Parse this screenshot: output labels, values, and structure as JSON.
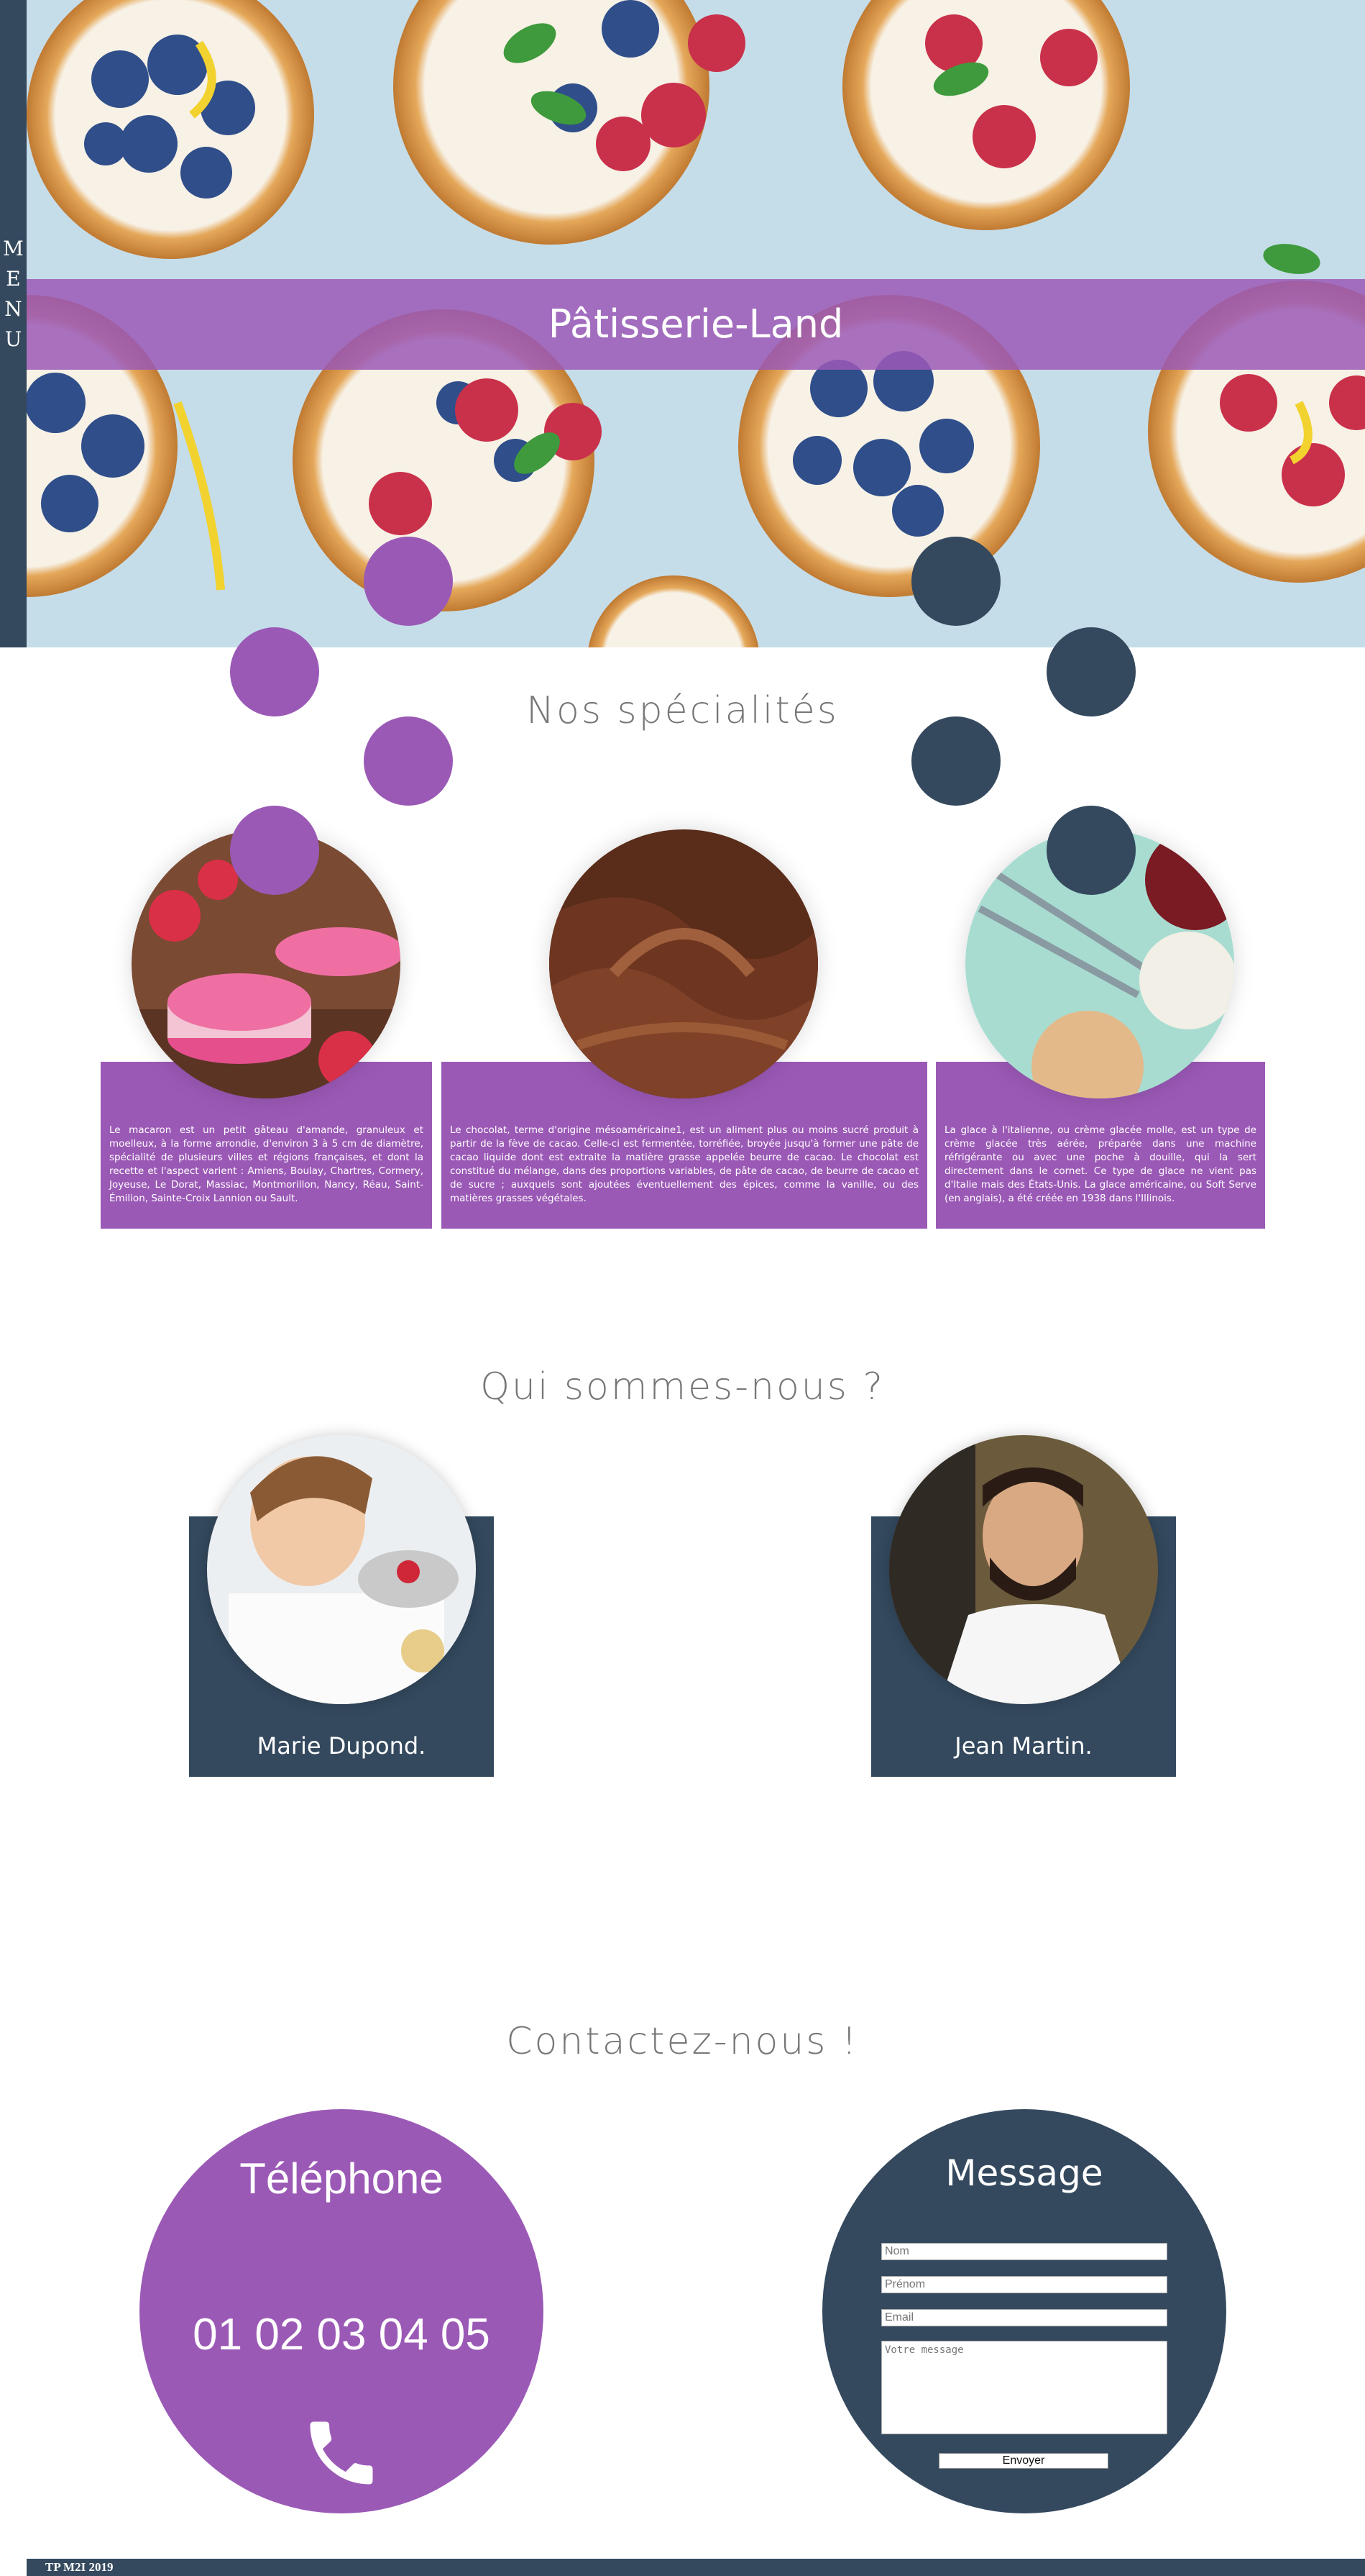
{
  "sidebar": {
    "menu_label": "MENU"
  },
  "hero": {
    "title": "Pâtisserie-Land"
  },
  "specialties": {
    "title": "Nos spécialités",
    "items": [
      {
        "name": "macaron",
        "text": "Le macaron est un petit gâteau d'amande, granuleux et moelleux, à la forme arrondie, d'environ 3 à 5 cm de diamètre, spécialité de plusieurs villes et régions françaises, et dont la recette et l'aspect varient : Amiens, Boulay, Chartres, Cormery, Joyeuse, Le Dorat, Massiac, Montmorillon, Nancy, Réau, Saint-Émilion, Sainte-Croix Lannion ou Sault."
      },
      {
        "name": "chocolat",
        "text": "Le chocolat, terme d'origine mésoaméricaine1, est un aliment plus ou moins sucré produit à partir de la fève de cacao. Celle-ci est fermentée, torréfiée, broyée jusqu'à former une pâte de cacao liquide dont est extraite la matière grasse appelée beurre de cacao. Le chocolat est constitué du mélange, dans des proportions variables, de pâte de cacao, de beurre de cacao et de sucre ; auxquels sont ajoutées éventuellement des épices, comme la vanille, ou des matières grasses végétales."
      },
      {
        "name": "glace",
        "text": "La glace à l'italienne, ou crème glacée molle, est un type de crème glacée très aérée, préparée dans une machine réfrigérante ou avec une poche à douille, qui la sert directement dans le cornet. Ce type de glace ne vient pas d'Italie mais des États-Unis. La glace américaine, ou Soft Serve (en anglais), a été créée en 1938 dans l'Illinois."
      }
    ]
  },
  "team": {
    "title": "Qui sommes-nous ?",
    "members": [
      {
        "name": "Marie Dupond."
      },
      {
        "name": "Jean Martin."
      }
    ]
  },
  "contact": {
    "title": "Contactez-nous !",
    "phone_title": "Téléphone",
    "phone_number": "01 02 03 04 05",
    "message_title": "Message",
    "placeholders": {
      "nom": "Nom",
      "prenom": "Prénom",
      "email": "Email",
      "message": "Votre message"
    },
    "send_label": "Envoyer"
  },
  "footer": {
    "text": "TP M2I 2019"
  },
  "colors": {
    "purple": "#9b59b6",
    "navy": "#34495e",
    "title_gray": "#777777"
  },
  "icons": {
    "phone": "phone-icon"
  }
}
